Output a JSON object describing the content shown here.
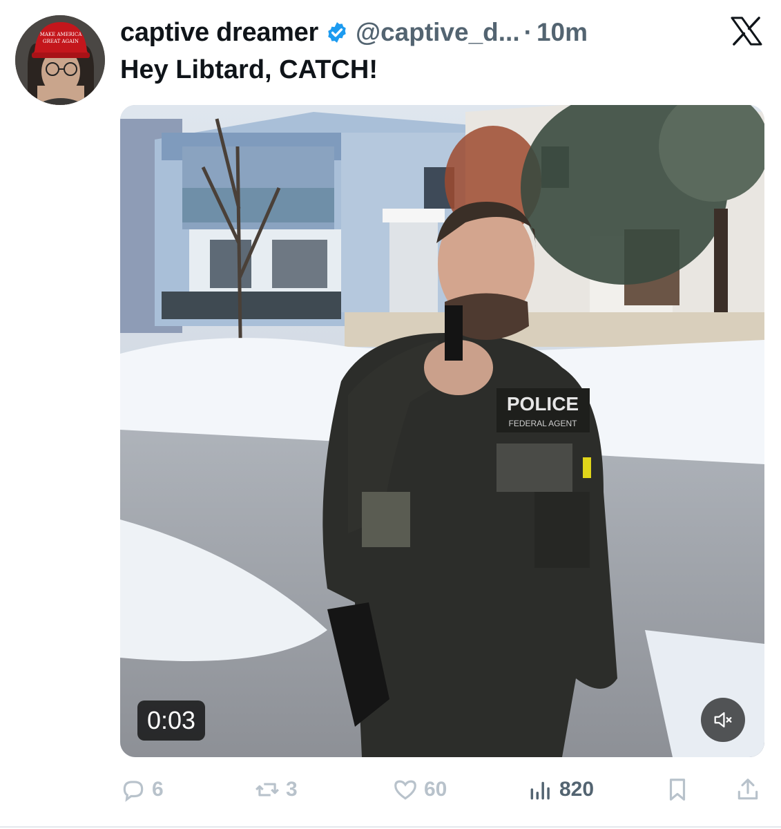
{
  "tweet": {
    "display_name": "captive dreamer",
    "handle": "@captive_d...",
    "separator": "·",
    "time": "10m",
    "text": "Hey Libtard, CATCH!",
    "avatar_hat_text_line1": "MAKE AMERICA",
    "avatar_hat_text_line2": "GREAT AGAIN"
  },
  "media": {
    "duration": "0:03",
    "vest_label": "POLICE",
    "vest_sublabel": "FEDERAL AGENT",
    "mute_icon": "speaker-muted-icon"
  },
  "actions": {
    "replies": "6",
    "reposts": "3",
    "likes": "60",
    "views": "820"
  },
  "colors": {
    "verified": "#1d9bf0",
    "text": "#0f1419",
    "secondary": "#536471",
    "action_faded": "#b8c2cb"
  }
}
